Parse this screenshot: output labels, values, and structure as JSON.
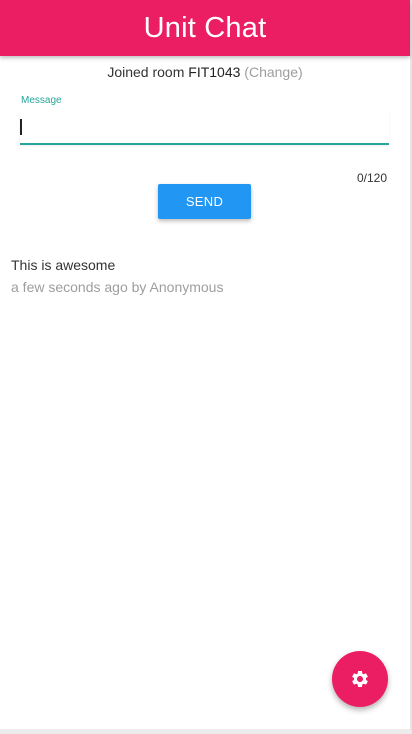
{
  "header": {
    "title": "Unit Chat"
  },
  "room": {
    "prefix": "Joined room",
    "code": "FIT1043",
    "change_label": "(Change)"
  },
  "message_field": {
    "label": "Message",
    "value": "",
    "counter": "0/120"
  },
  "send_button": {
    "label": "SEND"
  },
  "messages": [
    {
      "text": "This is awesome",
      "meta": "a few seconds ago by Anonymous"
    }
  ],
  "fab": {
    "icon": "gear-icon"
  },
  "colors": {
    "header": "#ec1e63",
    "fab": "#ec1e63",
    "send_button": "#2196f3",
    "input_accent": "#26a69a",
    "muted_text": "#9e9e9e"
  }
}
